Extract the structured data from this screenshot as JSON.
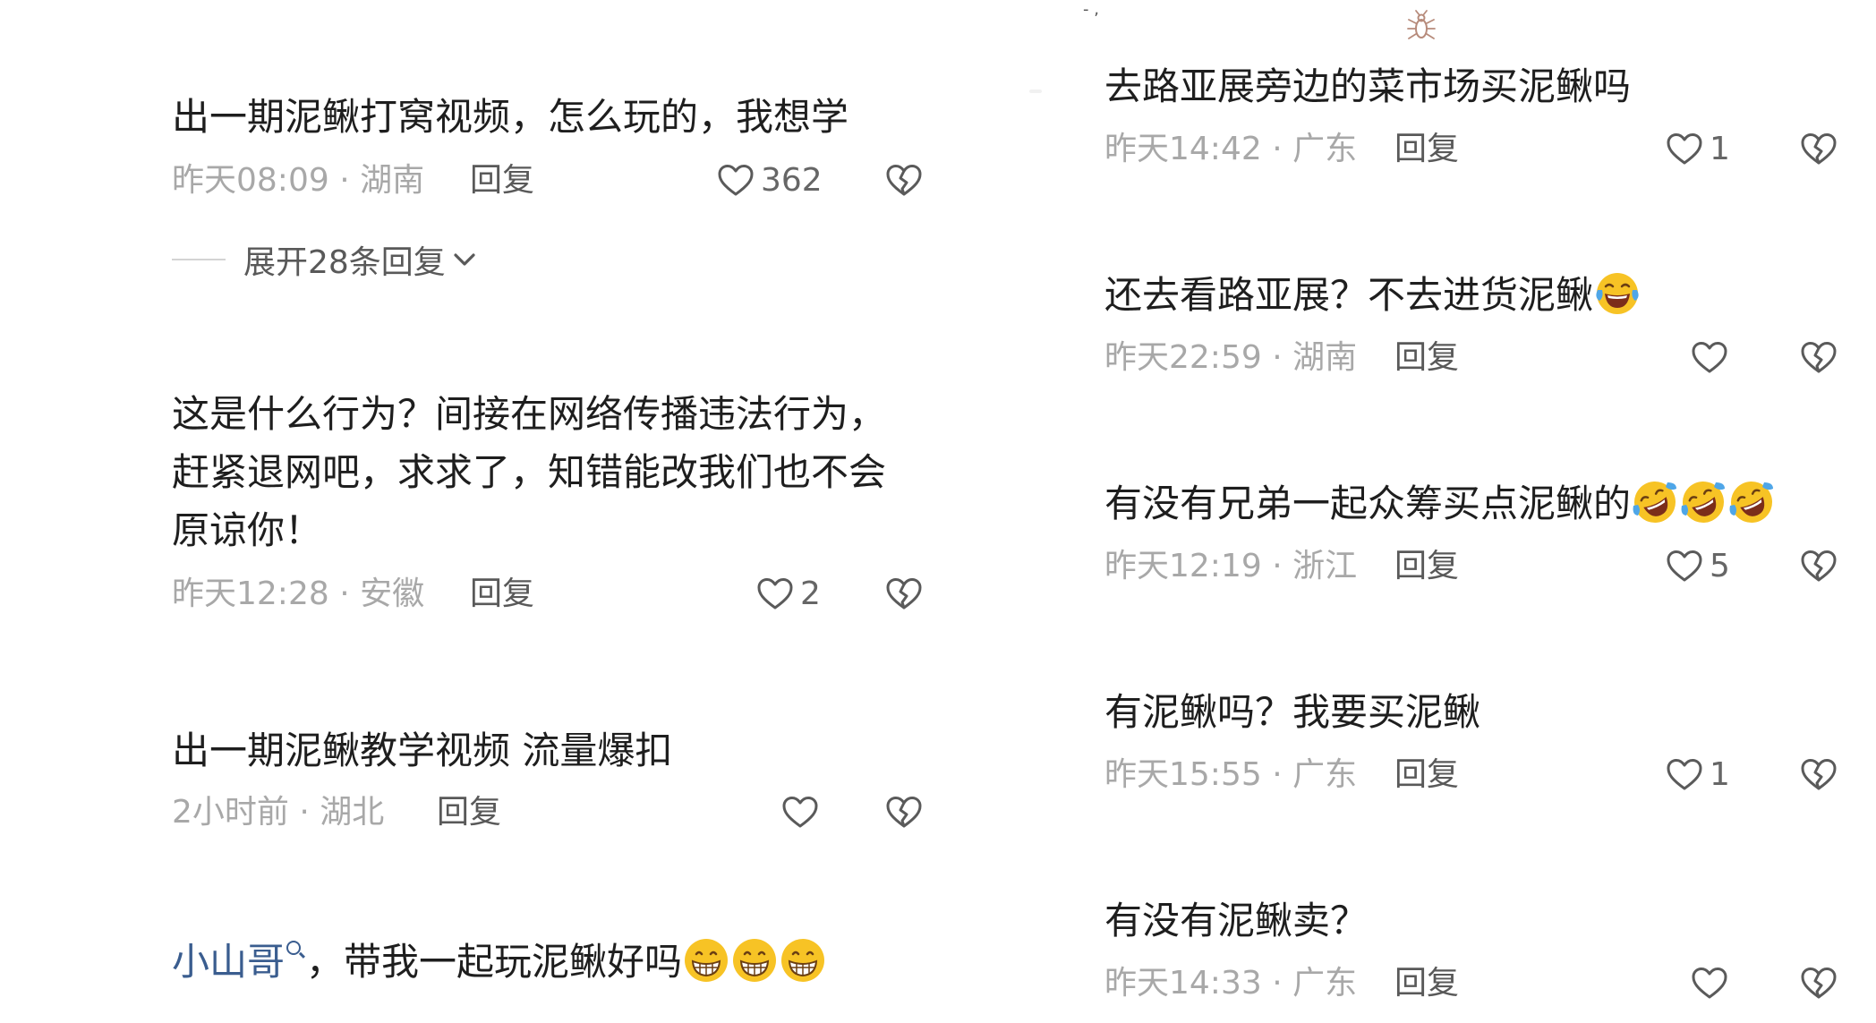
{
  "left": {
    "comments": [
      {
        "text": "出一期泥鳅打窝视频，怎么玩的，我想学",
        "time_location": "昨天08:09 · 湖南",
        "reply_label": "回复",
        "likes": "362",
        "expand_label": "展开28条回复"
      },
      {
        "text": "这是什么行为？间接在网络传播违法行为，赶紧退网吧，求求了，知错能改我们也不会原谅你！",
        "time_location": "昨天12:28 · 安徽",
        "reply_label": "回复",
        "likes": "2"
      },
      {
        "text": "出一期泥鳅教学视频 流量爆扣",
        "time_location": "2小时前 · 湖北",
        "reply_label": "回复"
      },
      {
        "mention": "小山哥",
        "text": "，带我一起玩泥鳅好吗",
        "emoji": "grinning-face-emoji"
      }
    ]
  },
  "right": {
    "top_mark": "- ,",
    "comments": [
      {
        "text": "去路亚展旁边的菜市场买泥鳅吗",
        "time_location": "昨天14:42 · 广东",
        "reply_label": "回复",
        "likes": "1"
      },
      {
        "text": "还去看路亚展？不去进货泥鳅",
        "time_location": "昨天22:59 · 湖南",
        "reply_label": "回复",
        "emoji": "tears-of-joy-emoji"
      },
      {
        "text": "有没有兄弟一起众筹买点泥鳅的",
        "time_location": "昨天12:19 · 浙江",
        "reply_label": "回复",
        "likes": "5",
        "emoji": "rolling-laughing-emoji"
      },
      {
        "text": "有泥鳅吗？我要买泥鳅",
        "time_location": "昨天15:55 · 广东",
        "reply_label": "回复",
        "likes": "1"
      },
      {
        "text": "有没有泥鳅卖？",
        "time_location": "昨天14:33 · 广东",
        "reply_label": "回复"
      }
    ]
  },
  "colors": {
    "text": "#1e1e1e",
    "meta": "#a8a8a8",
    "reply": "#595959",
    "mention": "#3a5d8f",
    "icon_stroke": "#5a5a5a",
    "emoji_face": "#f7c325"
  }
}
